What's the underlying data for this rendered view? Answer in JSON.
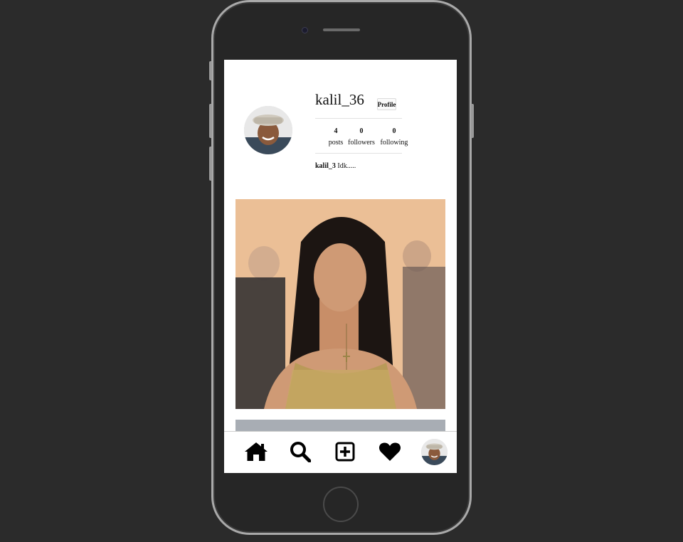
{
  "profile": {
    "username": "kalil_36",
    "profile_button_label": "Profile",
    "stats": [
      {
        "count": "4",
        "label": "posts"
      },
      {
        "count": "0",
        "label": "followers"
      },
      {
        "count": "0",
        "label": "following"
      }
    ],
    "bio_handle": "kalil_3",
    "bio_text": " Idk....."
  },
  "nav": {
    "items": [
      "home-icon",
      "search-icon",
      "add-post-icon",
      "heart-icon",
      "profile-avatar"
    ]
  },
  "colors": {
    "page_bg": "#2b2b2b",
    "phone_frame": "#a9a9a9",
    "screen_bg": "#ffffff"
  }
}
